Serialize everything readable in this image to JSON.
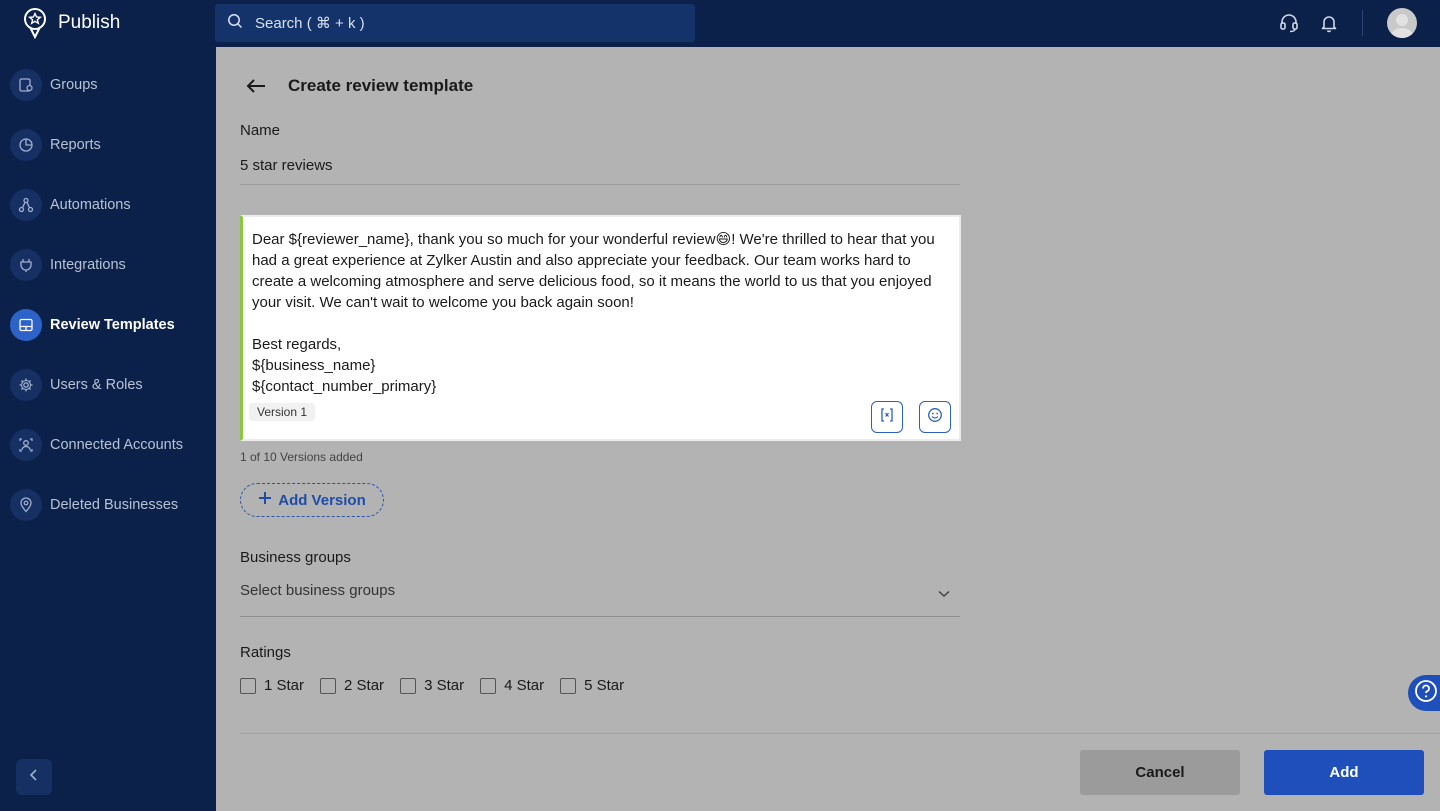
{
  "app": {
    "name": "Publish"
  },
  "search": {
    "placeholder": "Search ( ⌘ + k )"
  },
  "topbar": {
    "icons": [
      "headset-icon",
      "bell-icon"
    ],
    "avatar": "user-avatar"
  },
  "sidebar": {
    "items": [
      {
        "label": "Groups",
        "icon": "groups-icon",
        "active": false
      },
      {
        "label": "Reports",
        "icon": "pie-chart-icon",
        "active": false
      },
      {
        "label": "Automations",
        "icon": "automation-icon",
        "active": false
      },
      {
        "label": "Integrations",
        "icon": "plug-icon",
        "active": false
      },
      {
        "label": "Review Templates",
        "icon": "template-icon",
        "active": true
      },
      {
        "label": "Users & Roles",
        "icon": "gear-icon",
        "active": false
      },
      {
        "label": "Connected Accounts",
        "icon": "accounts-icon",
        "active": false
      },
      {
        "label": "Deleted Businesses",
        "icon": "location-pin-icon",
        "active": false
      }
    ],
    "collapse_icon": "chevron-left-icon"
  },
  "page": {
    "title": "Create review template"
  },
  "form": {
    "name_label": "Name",
    "name_value": "5 star reviews",
    "message": "Dear ${reviewer_name}, thank you so much for your wonderful review😄! We're thrilled to hear that you had a great experience at Zylker Austin and also appreciate your feedback. Our team works hard to create a welcoming atmosphere and serve delicious food, so it means the world to us that you enjoyed your visit. We can't wait to welcome you back again soon!\n\nBest regards,\n${business_name}\n${contact_number_primary}",
    "version_chip": "Version 1",
    "versions_count": "1 of 10 Versions added",
    "add_version_label": "Add Version",
    "business_groups_label": "Business groups",
    "business_groups_placeholder": "Select business groups",
    "ratings_label": "Ratings",
    "ratings": [
      {
        "label": "1 Star",
        "checked": false
      },
      {
        "label": "2 Star",
        "checked": false
      },
      {
        "label": "3 Star",
        "checked": false
      },
      {
        "label": "4 Star",
        "checked": false
      },
      {
        "label": "5 Star",
        "checked": false
      }
    ]
  },
  "actions": {
    "cancel": "Cancel",
    "add": "Add"
  },
  "colors": {
    "nav_bg": "#0c2149",
    "accent": "#1e4fba",
    "editor_border_left": "#8ac63f"
  }
}
